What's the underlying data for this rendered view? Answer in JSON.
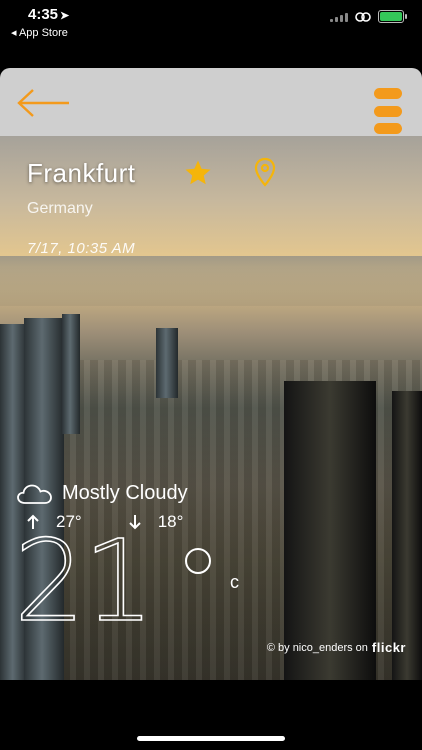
{
  "status_bar": {
    "time": "4:35",
    "back_app": "◂ App Store"
  },
  "header": {
    "back_icon": "arrow-left-icon",
    "menu_icon": "menu-dots-icon",
    "accent_color": "#f39a1c"
  },
  "location": {
    "city": "Frankfurt",
    "country": "Germany",
    "datetime": "7/17, 10:35 AM",
    "favorite_icon": "star-icon",
    "location_icon": "map-pin-icon"
  },
  "weather": {
    "condition": "Mostly Cloudy",
    "condition_icon": "cloud-icon",
    "high": "27°",
    "low": "18°",
    "temperature": "21",
    "unit": "c"
  },
  "credit": {
    "text": "© by nico_enders on",
    "brand": "flickr"
  }
}
